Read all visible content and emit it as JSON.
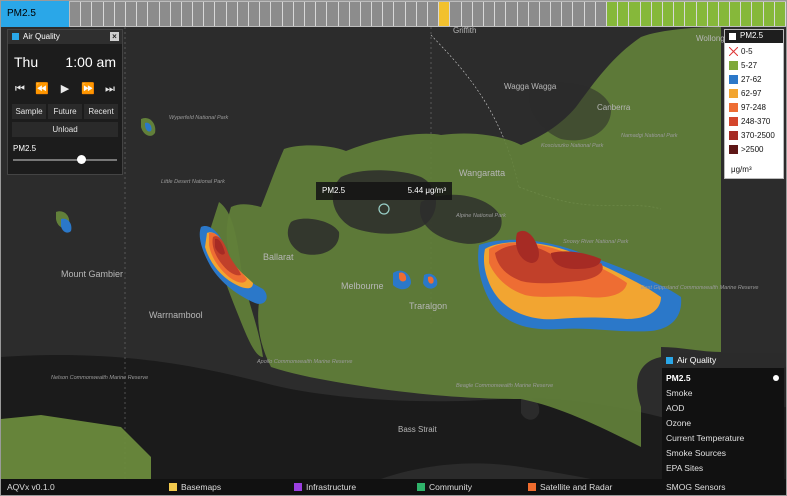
{
  "timeline": {
    "label": "PM2.5",
    "segments": [
      {
        "count": 33,
        "color": "#8c8c8c"
      },
      {
        "count": 1,
        "color": "#f2c12e"
      },
      {
        "count": 14,
        "color": "#8c8c8c"
      },
      {
        "count": 16,
        "color": "#86b83a"
      }
    ]
  },
  "controls": {
    "panel_title": "Air Quality",
    "close_label": "×",
    "day": "Thu",
    "time": "1:00 am",
    "buttons": {
      "sample": "Sample",
      "future": "Future",
      "recent": "Recent",
      "unload": "Unload"
    },
    "param_label": "PM2.5",
    "slider_level": 0.65
  },
  "tooltip": {
    "param": "PM2.5",
    "value": "5.44 μg/m³"
  },
  "legend": {
    "title": "PM2.5",
    "unit": "μg/m³",
    "items": [
      {
        "label": "0-5",
        "color": "#ffffff"
      },
      {
        "label": "5-27",
        "color": "#7fa83a"
      },
      {
        "label": "27-62",
        "color": "#2b78c9"
      },
      {
        "label": "62-97",
        "color": "#f2a531"
      },
      {
        "label": "97-248",
        "color": "#ee6d33"
      },
      {
        "label": "248-370",
        "color": "#d4462c"
      },
      {
        "label": "370-2500",
        "color": "#a62b24"
      },
      {
        "label": ">2500",
        "color": "#5e1616"
      }
    ]
  },
  "layers": {
    "title": "Air Quality",
    "items": [
      "PM2.5",
      "Smoke",
      "AOD",
      "Ozone",
      "Current Temperature",
      "Smoke Sources",
      "EPA Sites",
      "SMOG Sensors"
    ]
  },
  "footer": {
    "version": "AQVx v0.1.0",
    "categories": [
      {
        "label": "Basemaps",
        "color": "#f2c94c"
      },
      {
        "label": "Infrastructure",
        "color": "#9b3fe0"
      },
      {
        "label": "Community",
        "color": "#2fb36a"
      },
      {
        "label": "Satellite and Radar",
        "color": "#ef6c2e"
      }
    ],
    "extra": "SMOG Sensors"
  },
  "map": {
    "places": [
      "Griffith",
      "Wagga Wagga",
      "Wollongong",
      "Canberra",
      "Wangaratta",
      "Ballarat",
      "Melbourne",
      "Traralgon",
      "Mount Gambier",
      "Warrnambool",
      "Bass Strait"
    ],
    "parks": [
      "Wyperfeld National Park",
      "Little Desert National Park",
      "Kosciuszko National Park",
      "Namadgi National Park",
      "Alpine National Park",
      "Snowy River National Park",
      "East Gippsland Commonwealth Marine Reserve",
      "Apollo Commonwealth Marine Reserve",
      "Beagle Commonwealth Marine Reserve",
      "Nelson Commonwealth Marine Reserve"
    ]
  }
}
